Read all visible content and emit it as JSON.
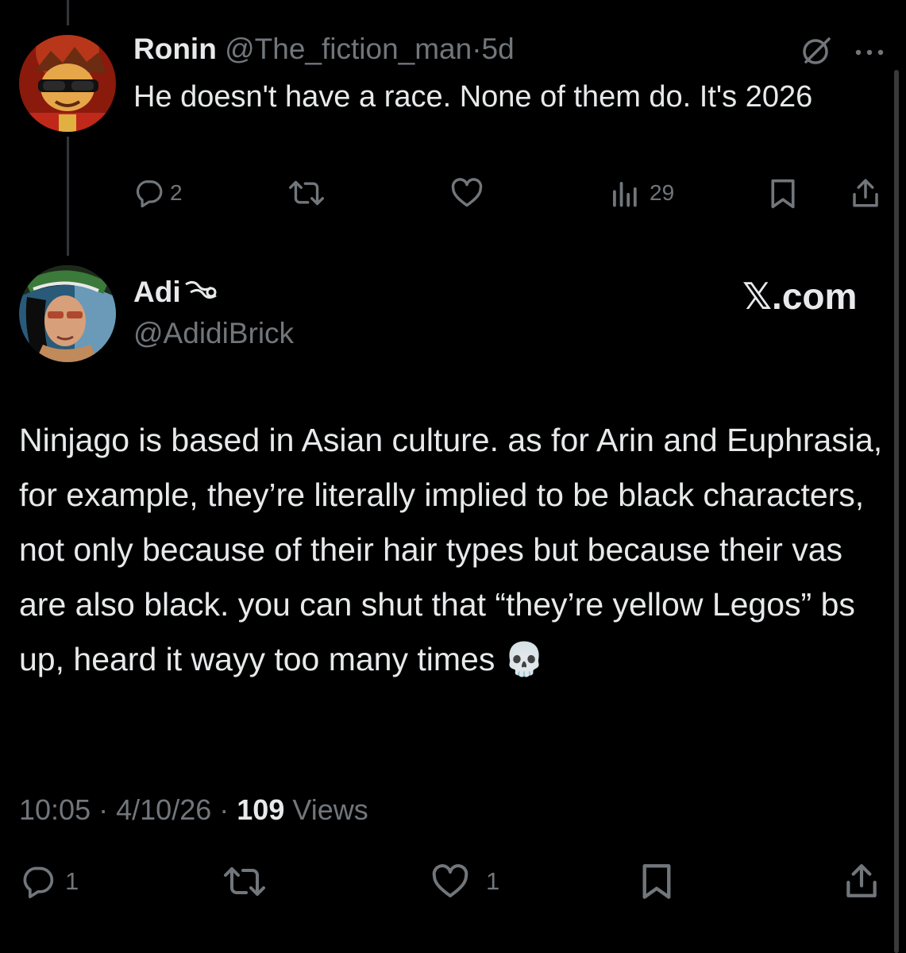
{
  "reply": {
    "name": "Ronin",
    "handle": "@The_fiction_man",
    "separator": "·",
    "age": "5d",
    "text": "He doesn't have a race. None of them do. It's 2026",
    "stats": {
      "replies": "2",
      "views": "29"
    }
  },
  "quoted": {
    "name": "Adi",
    "handle": "@AdidiBrick",
    "source": "𝕏.com",
    "text": "Ninjago is based in Asian culture. as for Arin and Euphrasia, for example, they’re literally implied to be black characters, not only because of their hair types but because their vas are also black. you can shut that “they’re yellow Legos” bs up, heard it wayy too many times 💀",
    "time": "10:05",
    "date": "4/10/26",
    "views_count": "109",
    "views_label": "Views",
    "separator": "·",
    "stats": {
      "replies": "1",
      "likes": "1"
    }
  },
  "colors": {
    "background": "#000000",
    "text": "#e7e9ea",
    "muted": "#71767b"
  },
  "icons": [
    "reply-icon",
    "repost-icon",
    "like-icon",
    "views-icon",
    "bookmark-icon",
    "share-icon",
    "grok-icon",
    "more-icon"
  ]
}
